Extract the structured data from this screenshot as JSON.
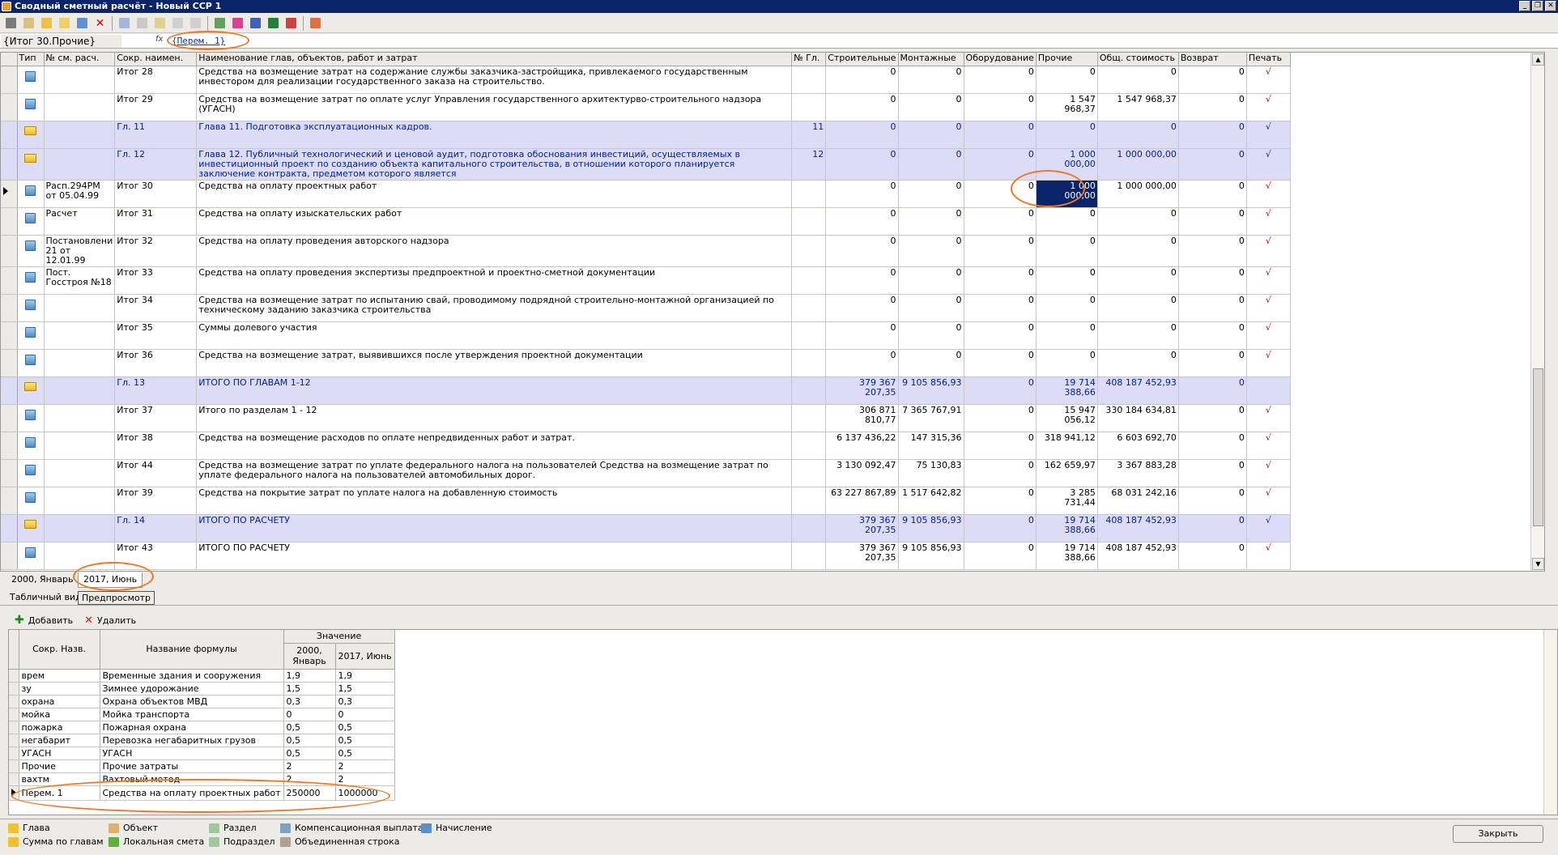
{
  "window": {
    "title": "Сводный сметный расчёт - Новый ССР 1"
  },
  "formula_bar": {
    "cell_ref": "{Итог 30.Прочие}",
    "fx": "fx",
    "value": "{Перем. 1}"
  },
  "grid": {
    "headers": [
      "Тип",
      "№ см. расч.",
      "Сокр. наимен.",
      "Наименование глав, объектов, работ и затрат",
      "№ Гл.",
      "Строительные",
      "Монтажные",
      "Оборудование",
      "Прочие",
      "Общ. стоимость",
      "Возврат",
      "Печать"
    ],
    "rows": [
      {
        "type": "doc",
        "calc": "",
        "short": "Итог 28",
        "name": "Средства на возмещение затрат на содержание службы заказчика-застройщика, привлекаемого государственным инвестором для реализации государственного заказа на строительство.",
        "ch": "",
        "s": "0",
        "m": "0",
        "o": "0",
        "p": "0",
        "t": "0",
        "v": "0",
        "print": "√"
      },
      {
        "type": "doc",
        "calc": "",
        "short": "Итог 29",
        "name": "Средства на возмещение затрат по оплате услуг Управления государственного архитектурво-строительного надзора (УГАСН)",
        "ch": "",
        "s": "0",
        "m": "0",
        "o": "0",
        "p": "1 547 968,37",
        "t": "1 547 968,37",
        "v": "0",
        "print": "√"
      },
      {
        "type": "folder",
        "calc": "",
        "short": "Гл. 11",
        "name": "Глава 11. Подготовка эксплуатационных кадров.",
        "ch": "11",
        "s": "0",
        "m": "0",
        "o": "0",
        "p": "0",
        "t": "0",
        "v": "0",
        "print": "√"
      },
      {
        "type": "folder",
        "calc": "",
        "short": "Гл. 12",
        "name": "Глава 12. Публичный технологический и ценовой аудит, подготовка обоснования инвестиций, осуществляемых в инвестиционный проект по созданию объекта капитального строительства, в отношении которого планируется заключение контракта, предметом которого является",
        "ch": "12",
        "s": "0",
        "m": "0",
        "o": "0",
        "p": "1 000 000,00",
        "t": "1 000 000,00",
        "v": "0",
        "print": "√"
      },
      {
        "type": "doc",
        "calc": "Расп.294РМ от 05.04.99",
        "short": "Итог 30",
        "name": "Средства на оплату проектных работ",
        "ch": "",
        "s": "0",
        "m": "0",
        "o": "0",
        "p": "1 000 000,00",
        "t": "1 000 000,00",
        "v": "0",
        "print": "√",
        "current": true
      },
      {
        "type": "doc",
        "calc": "Расчет",
        "short": "Итог 31",
        "name": "Средства на оплату изыскательских работ",
        "ch": "",
        "s": "0",
        "m": "0",
        "o": "0",
        "p": "0",
        "t": "0",
        "v": "0",
        "print": "√"
      },
      {
        "type": "doc",
        "calc": "Постановлени 21 от 12.01.99",
        "short": "Итог 32",
        "name": "Средства на оплату проведения авторского надзора",
        "ch": "",
        "s": "0",
        "m": "0",
        "o": "0",
        "p": "0",
        "t": "0",
        "v": "0",
        "print": "√"
      },
      {
        "type": "doc",
        "calc": "Пост. Госстроя №18",
        "short": "Итог 33",
        "name": "Средства на оплату проведения экспертизы предпроектной и проектно-сметной документации",
        "ch": "",
        "s": "0",
        "m": "0",
        "o": "0",
        "p": "0",
        "t": "0",
        "v": "0",
        "print": "√"
      },
      {
        "type": "doc",
        "calc": "",
        "short": "Итог 34",
        "name": "Средства на возмещение затрат по испытанию свай, проводимому подрядной строительно-монтажной организацией по техническому заданию заказчика строительства",
        "ch": "",
        "s": "0",
        "m": "0",
        "o": "0",
        "p": "0",
        "t": "0",
        "v": "0",
        "print": "√"
      },
      {
        "type": "doc",
        "calc": "",
        "short": "Итог 35",
        "name": "Суммы долевого участия",
        "ch": "",
        "s": "0",
        "m": "0",
        "o": "0",
        "p": "0",
        "t": "0",
        "v": "0",
        "print": "√"
      },
      {
        "type": "doc",
        "calc": "",
        "short": "Итог 36",
        "name": "Средства на возмещение затрат, выявившихся после утверждения проектной документации",
        "ch": "",
        "s": "0",
        "m": "0",
        "o": "0",
        "p": "0",
        "t": "0",
        "v": "0",
        "print": "√"
      },
      {
        "type": "folder",
        "calc": "",
        "short": "Гл. 13",
        "name": " ИТОГО ПО ГЛАВАМ 1-12",
        "ch": "",
        "s": "379 367 207,35",
        "m": "9 105 856,93",
        "o": "0",
        "p": "19 714 388,66",
        "t": "408 187 452,93",
        "v": "0",
        "print": ""
      },
      {
        "type": "doc",
        "calc": "",
        "short": "Итог 37",
        "name": "Итого по разделам 1 - 12",
        "ch": "",
        "s": "306 871 810,77",
        "m": "7 365 767,91",
        "o": "0",
        "p": "15 947 056,12",
        "t": "330 184 634,81",
        "v": "0",
        "print": "√"
      },
      {
        "type": "doc",
        "calc": "",
        "short": "Итог 38",
        "name": "Средства на возмещение расходов по оплате непредвиденных работ и затрат.",
        "ch": "",
        "s": "6 137 436,22",
        "m": "147 315,36",
        "o": "0",
        "p": "318 941,12",
        "t": "6 603 692,70",
        "v": "0",
        "print": "√"
      },
      {
        "type": "doc",
        "calc": "",
        "short": "Итог 44",
        "name": "Средства на возмещение затрат по уплате федерального налога на пользователей Средства на возмещение затрат по уплате федерального налога на пользователей автомобильных дорог.",
        "ch": "",
        "s": "3 130 092,47",
        "m": "75 130,83",
        "o": "0",
        "p": "162 659,97",
        "t": "3 367 883,28",
        "v": "0",
        "print": "√"
      },
      {
        "type": "doc",
        "calc": "",
        "short": "Итог 39",
        "name": "Средства на покрытие затрат по уплате налога на добавленную стоимость",
        "ch": "",
        "s": "63 227 867,89",
        "m": "1 517 642,82",
        "o": "0",
        "p": "3 285 731,44",
        "t": "68 031 242,16",
        "v": "0",
        "print": "√"
      },
      {
        "type": "folder",
        "calc": "",
        "short": "Гл. 14",
        "name": "ИТОГО ПО РАСЧЕТУ",
        "ch": "",
        "s": "379 367 207,35",
        "m": "9 105 856,93",
        "o": "0",
        "p": "19 714 388,66",
        "t": "408 187 452,93",
        "v": "0",
        "print": "√"
      },
      {
        "type": "doc",
        "calc": "",
        "short": "Итог 43",
        "name": "ИТОГО ПО РАСЧЕТУ",
        "ch": "",
        "s": "379 367 207,35",
        "m": "9 105 856,93",
        "o": "0",
        "p": "19 714 388,66",
        "t": "408 187 452,93",
        "v": "0",
        "print": "√"
      }
    ]
  },
  "period_tabs": [
    "2000, Январь",
    "2017, Июнь"
  ],
  "view_tabs": [
    "Табличный вид",
    "Предпросмотр"
  ],
  "lower_toolbar": {
    "add": "Добавить",
    "delete": "Удалить"
  },
  "formulas": {
    "h_short": "Сокр. Назв.",
    "h_name": "Название формулы",
    "h_value": "Значение",
    "h_p1": "2000, Январь",
    "h_p2": "2017, Июнь",
    "rows": [
      {
        "k": "врем",
        "n": "Временные здания и сооружения",
        "a": "1,9",
        "b": "1,9"
      },
      {
        "k": "зу",
        "n": "Зимнее удорожание",
        "a": "1,5",
        "b": "1,5"
      },
      {
        "k": "охрана",
        "n": "Охрана объектов МВД",
        "a": "0,3",
        "b": "0,3"
      },
      {
        "k": "мойка",
        "n": "Мойка транспорта",
        "a": "0",
        "b": "0"
      },
      {
        "k": "пожарка",
        "n": "Пожарная охрана",
        "a": "0,5",
        "b": "0,5"
      },
      {
        "k": "негабарит",
        "n": "Перевозка негабаритных грузов",
        "a": "0,5",
        "b": "0,5"
      },
      {
        "k": "УГАСН",
        "n": "УГАСН",
        "a": "0,5",
        "b": "0,5"
      },
      {
        "k": "Прочие",
        "n": "Прочие затраты",
        "a": "2",
        "b": "2"
      },
      {
        "k": "вахтм",
        "n": "Вахтовый метод",
        "a": "2",
        "b": "2"
      },
      {
        "k": "Перем. 1",
        "n": "Средства на оплату проектных работ",
        "a": "250000",
        "b": "1000000",
        "current": true
      }
    ]
  },
  "legend": [
    "Глава",
    "Объект",
    "Раздел",
    "Компенсационная выплата",
    "Начисление",
    "Сумма по главам",
    "Локальная смета",
    "Подраздел",
    "Объединенная строка"
  ],
  "close_button": "Закрыть",
  "colors": {
    "chapter_row": "#dcdcf6",
    "chapter_text": "#0020a0",
    "selection": "#0a246a",
    "print_mark": "#c00000",
    "annotation": "#f07820"
  }
}
